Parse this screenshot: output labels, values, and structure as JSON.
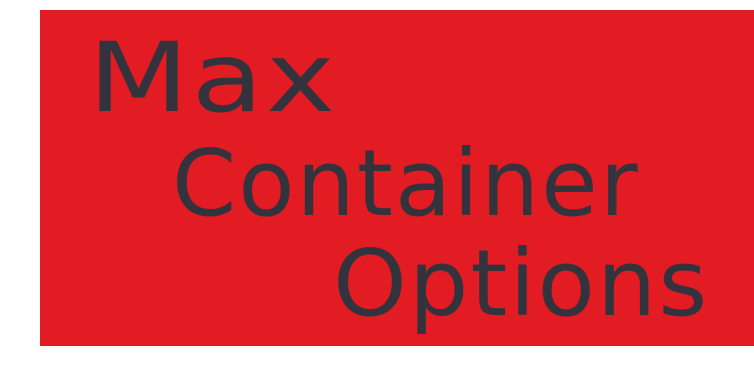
{
  "panel": {
    "background_color": "#e31b23",
    "text_color": "#33333d"
  },
  "headline": {
    "line_1": "Max",
    "line_2": "Container",
    "line_3": "Options"
  }
}
